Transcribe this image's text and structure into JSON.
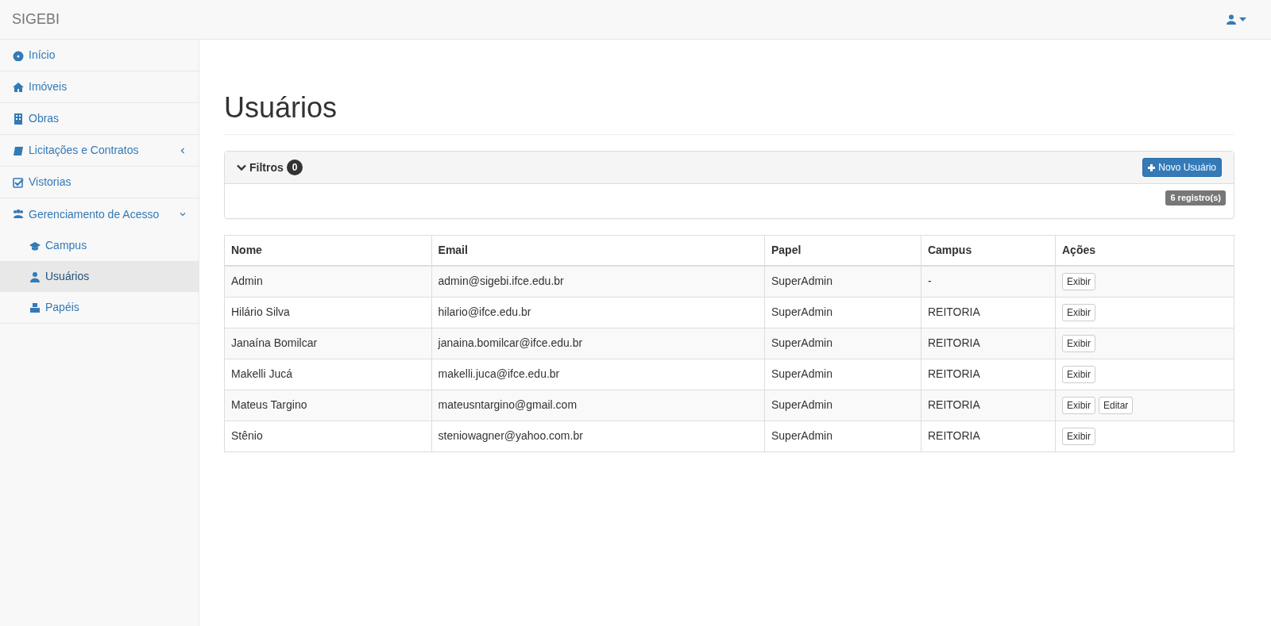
{
  "navbar": {
    "brand": "SIGEBI"
  },
  "sidebar": {
    "items": [
      {
        "label": "Início",
        "selected": false
      },
      {
        "label": "Imóveis",
        "selected": false
      },
      {
        "label": "Obras",
        "selected": false
      },
      {
        "label": "Licitações e Contratos",
        "expanded": false
      },
      {
        "label": "Vistorias",
        "selected": false
      },
      {
        "label": "Gerenciamento de Acesso",
        "expanded": true,
        "children": [
          {
            "label": "Campus",
            "selected": false
          },
          {
            "label": "Usuários",
            "selected": true
          },
          {
            "label": "Papéis",
            "selected": false
          }
        ]
      }
    ]
  },
  "page": {
    "title": "Usuários"
  },
  "filters": {
    "label": "Filtros",
    "count": "0",
    "expanded": true,
    "new_button": "Novo Usuário",
    "records": "6 registro(s)"
  },
  "table": {
    "columns": [
      "Nome",
      "Email",
      "Papel",
      "Campus",
      "Ações"
    ],
    "rows": [
      {
        "cells": [
          "Admin",
          "admin@sigebi.ifce.edu.br",
          "SuperAdmin",
          "-"
        ],
        "actions": [
          "Exibir"
        ]
      },
      {
        "cells": [
          "Hilário Silva",
          "hilario@ifce.edu.br",
          "SuperAdmin",
          "REITORIA"
        ],
        "actions": [
          "Exibir"
        ]
      },
      {
        "cells": [
          "Janaína Bomilcar",
          "janaina.bomilcar@ifce.edu.br",
          "SuperAdmin",
          "REITORIA"
        ],
        "actions": [
          "Exibir"
        ]
      },
      {
        "cells": [
          "Makelli Jucá",
          "makelli.juca@ifce.edu.br",
          "SuperAdmin",
          "REITORIA"
        ],
        "actions": [
          "Exibir"
        ]
      },
      {
        "cells": [
          "Mateus Targino",
          "mateusntargino@gmail.com",
          "SuperAdmin",
          "REITORIA"
        ],
        "actions": [
          "Exibir",
          "Editar"
        ]
      },
      {
        "cells": [
          "Stênio",
          "steniowagner@yahoo.com.br",
          "SuperAdmin",
          "REITORIA"
        ],
        "actions": [
          "Exibir"
        ]
      }
    ]
  }
}
